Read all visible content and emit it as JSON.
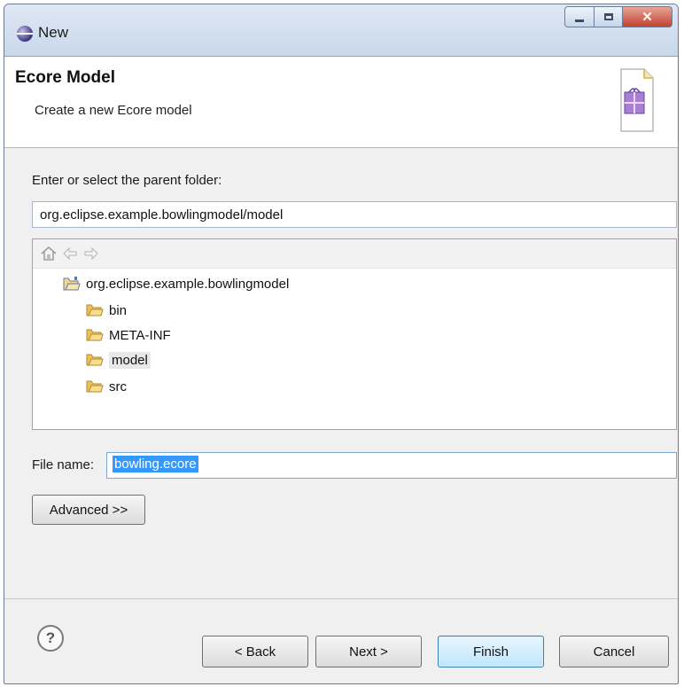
{
  "window": {
    "title": "New",
    "controls": {
      "minimize": "minimize",
      "maximize": "maximize",
      "close": "x"
    }
  },
  "banner": {
    "title": "Ecore Model",
    "description": "Create a new Ecore model",
    "icon": "new-ecore-file-icon"
  },
  "parent_folder": {
    "label": "Enter or select the parent folder:",
    "value": "org.eclipse.example.bowlingmodel/model"
  },
  "tree_toolbar": {
    "icons": [
      "home-icon",
      "back-arrow-icon",
      "forward-arrow-icon"
    ]
  },
  "tree": {
    "project": "org.eclipse.example.bowlingmodel",
    "folders": [
      {
        "label": "bin",
        "selected": false
      },
      {
        "label": "META-INF",
        "selected": false
      },
      {
        "label": "model",
        "selected": true
      },
      {
        "label": "src",
        "selected": false
      }
    ]
  },
  "file": {
    "label": "File name:",
    "value": "bowling.ecore"
  },
  "buttons": {
    "advanced": "Advanced >>",
    "help": "?",
    "back": "< Back",
    "next": "Next >",
    "finish": "Finish",
    "cancel": "Cancel"
  },
  "colors": {
    "accent": "#3399ff",
    "folder": "#e8b84a",
    "finish_border": "#3c7fb1"
  }
}
